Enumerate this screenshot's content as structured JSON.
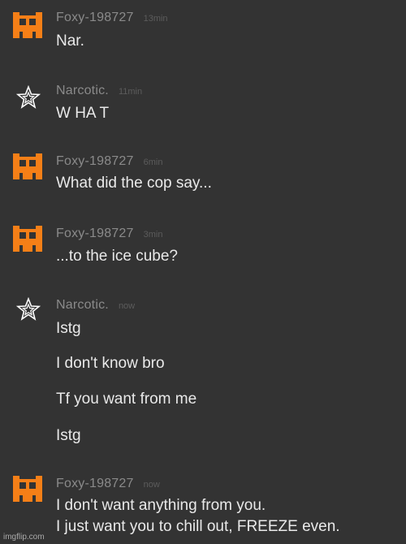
{
  "colors": {
    "background": "#333333",
    "username": "#8a8a8a",
    "timestamp": "#5c5c5c",
    "message_text": "#e9e9e9",
    "foxy_avatar": "#f57f17"
  },
  "messages": [
    {
      "author": "Foxy-198727",
      "avatar_icon": "orange-pixel-face-icon",
      "time": "13min",
      "lines": [
        "Nar."
      ]
    },
    {
      "author": "Narcotic.",
      "avatar_icon": "star-icon",
      "time": "11min",
      "lines": [
        "W HA T"
      ]
    },
    {
      "author": "Foxy-198727",
      "avatar_icon": "orange-pixel-face-icon",
      "time": "6min",
      "lines": [
        "What did the cop say..."
      ]
    },
    {
      "author": "Foxy-198727",
      "avatar_icon": "orange-pixel-face-icon",
      "time": "3min",
      "lines": [
        "...to the ice cube?"
      ]
    },
    {
      "author": "Narcotic.",
      "avatar_icon": "star-icon",
      "time": "now",
      "lines": [
        "Istg",
        "I don't know bro",
        "Tf you want from me",
        "Istg"
      ]
    },
    {
      "author": "Foxy-198727",
      "avatar_icon": "orange-pixel-face-icon",
      "time": "now",
      "lines": [
        "I don't want anything from you.",
        "I just want you to chill out, FREEZE even."
      ]
    }
  ],
  "watermark": "imgflip.com"
}
